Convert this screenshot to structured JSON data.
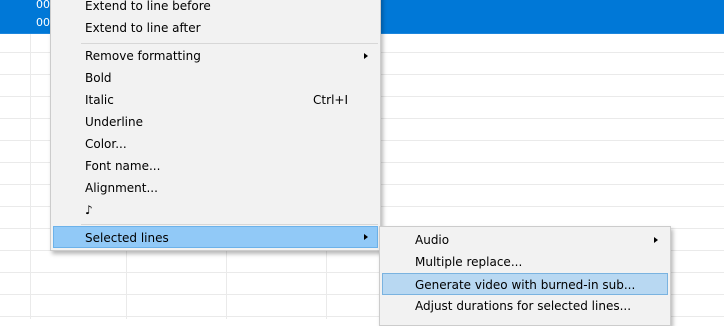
{
  "grid": {
    "selected_rows": [
      {
        "text": "00"
      },
      {
        "text": "00"
      }
    ]
  },
  "main_menu": {
    "items": [
      {
        "label": "Extend to line before",
        "shortcut": "",
        "submenu": false
      },
      {
        "label": "Extend to line after",
        "shortcut": "",
        "submenu": false
      },
      {
        "label": "Remove formatting",
        "shortcut": "",
        "submenu": true
      },
      {
        "label": "Bold",
        "shortcut": "",
        "submenu": false
      },
      {
        "label": "Italic",
        "shortcut": "Ctrl+I",
        "submenu": false
      },
      {
        "label": "Underline",
        "shortcut": "",
        "submenu": false
      },
      {
        "label": "Color...",
        "shortcut": "",
        "submenu": false
      },
      {
        "label": "Font name...",
        "shortcut": "",
        "submenu": false
      },
      {
        "label": "Alignment...",
        "shortcut": "",
        "submenu": false
      },
      {
        "label": "♪",
        "shortcut": "",
        "submenu": false
      },
      {
        "label": "Selected lines",
        "shortcut": "",
        "submenu": true,
        "state": "open"
      }
    ]
  },
  "sub_menu": {
    "items": [
      {
        "label": "Audio",
        "submenu": true
      },
      {
        "label": "Multiple replace...",
        "submenu": false
      },
      {
        "label": "Generate video with burned-in sub...",
        "submenu": false,
        "state": "hovered"
      },
      {
        "label": "Adjust durations for selected lines...",
        "submenu": false
      }
    ]
  },
  "colors": {
    "selection_blue": "#0078d7",
    "menu_background": "#f2f2f2",
    "menu_highlight": "#91c9f7",
    "hover_highlight": "#b8d8f2"
  }
}
